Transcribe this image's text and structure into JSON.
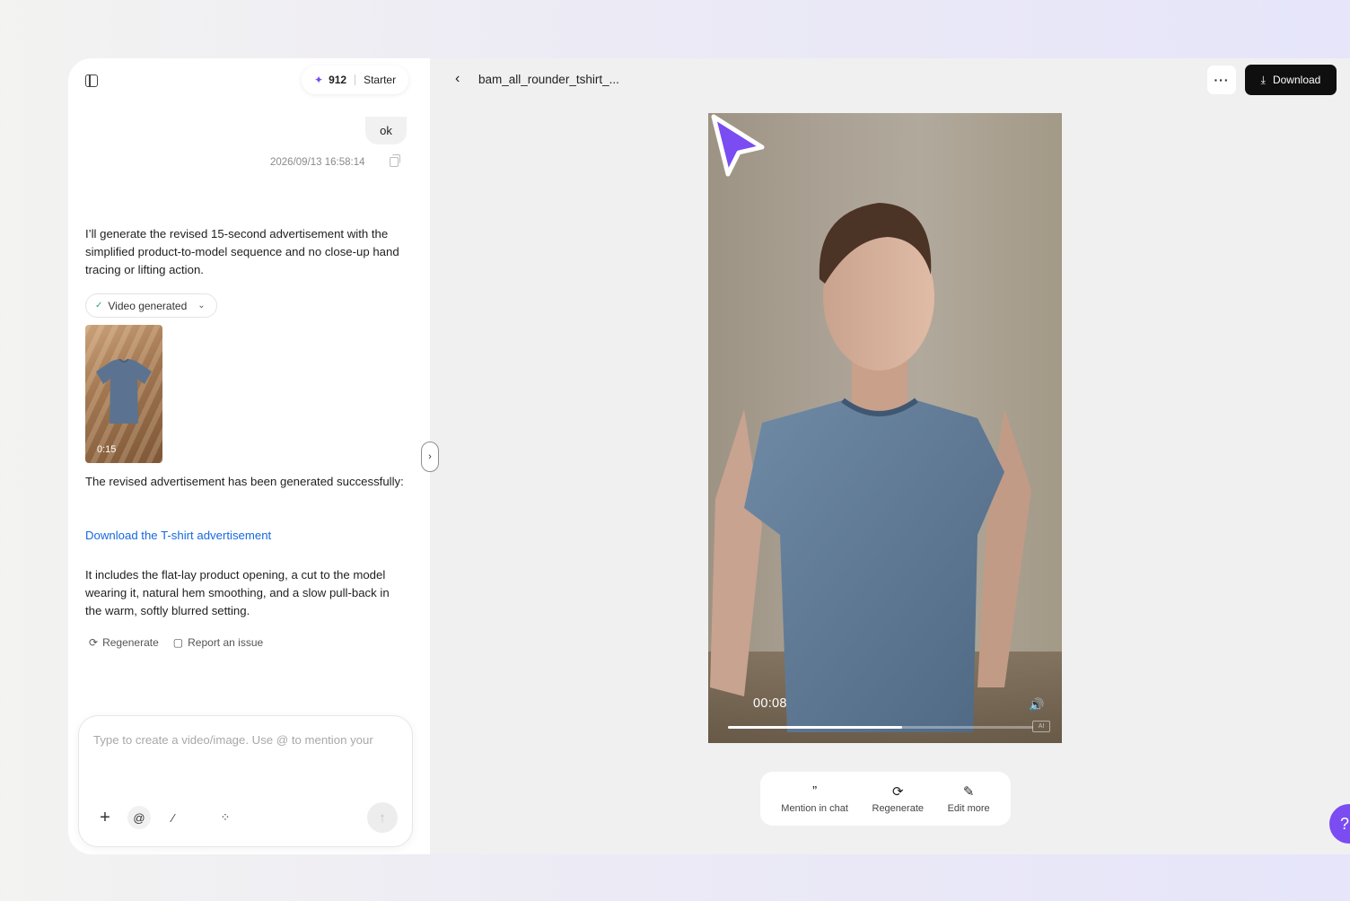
{
  "header": {
    "credits": "912",
    "plan": "Starter"
  },
  "chat": {
    "user_message": "ok",
    "timestamp": "2026/09/13 16:58:14",
    "assistant_intro": "I’ll generate the revised 15-second advertisement with the simplified product-to-model sequence and no close-up hand tracing or lifting action.",
    "status_chip": "Video generated",
    "thumbnail_duration": "0:15",
    "success_text": "The revised advertisement has been generated successfully:",
    "download_link": "Download the T-shirt advertisement",
    "summary": "It includes the flat-lay product opening, a cut to the model wearing it, natural hem smoothing, and a slow pull-back in the warm, softly blurred setting.",
    "actions": [
      {
        "label": "Regenerate",
        "icon": "refresh-icon"
      },
      {
        "label": "Report an issue",
        "icon": "report-icon"
      }
    ]
  },
  "composer": {
    "placeholder": "Type to create a video/image. Use @ to mention your",
    "tools": [
      "plus-icon",
      "at-icon",
      "magic-wand-icon",
      "grid-icon",
      "send-icon"
    ]
  },
  "preview": {
    "file_name": "bam_all_rounder_tshirt_...",
    "more_label": "···",
    "download_label": "Download",
    "current_time": "00:08",
    "playback_progress": 0.57,
    "bottom_actions": [
      {
        "label": "Mention in chat",
        "icon": "quote-icon"
      },
      {
        "label": "Regenerate",
        "icon": "refresh-icon"
      },
      {
        "label": "Edit more",
        "icon": "pencil-icon"
      }
    ]
  },
  "colors": {
    "accent": "#7a4cf2",
    "link": "#1769e0",
    "download_button": "#0f0f0f",
    "success": "#2fa46a"
  }
}
